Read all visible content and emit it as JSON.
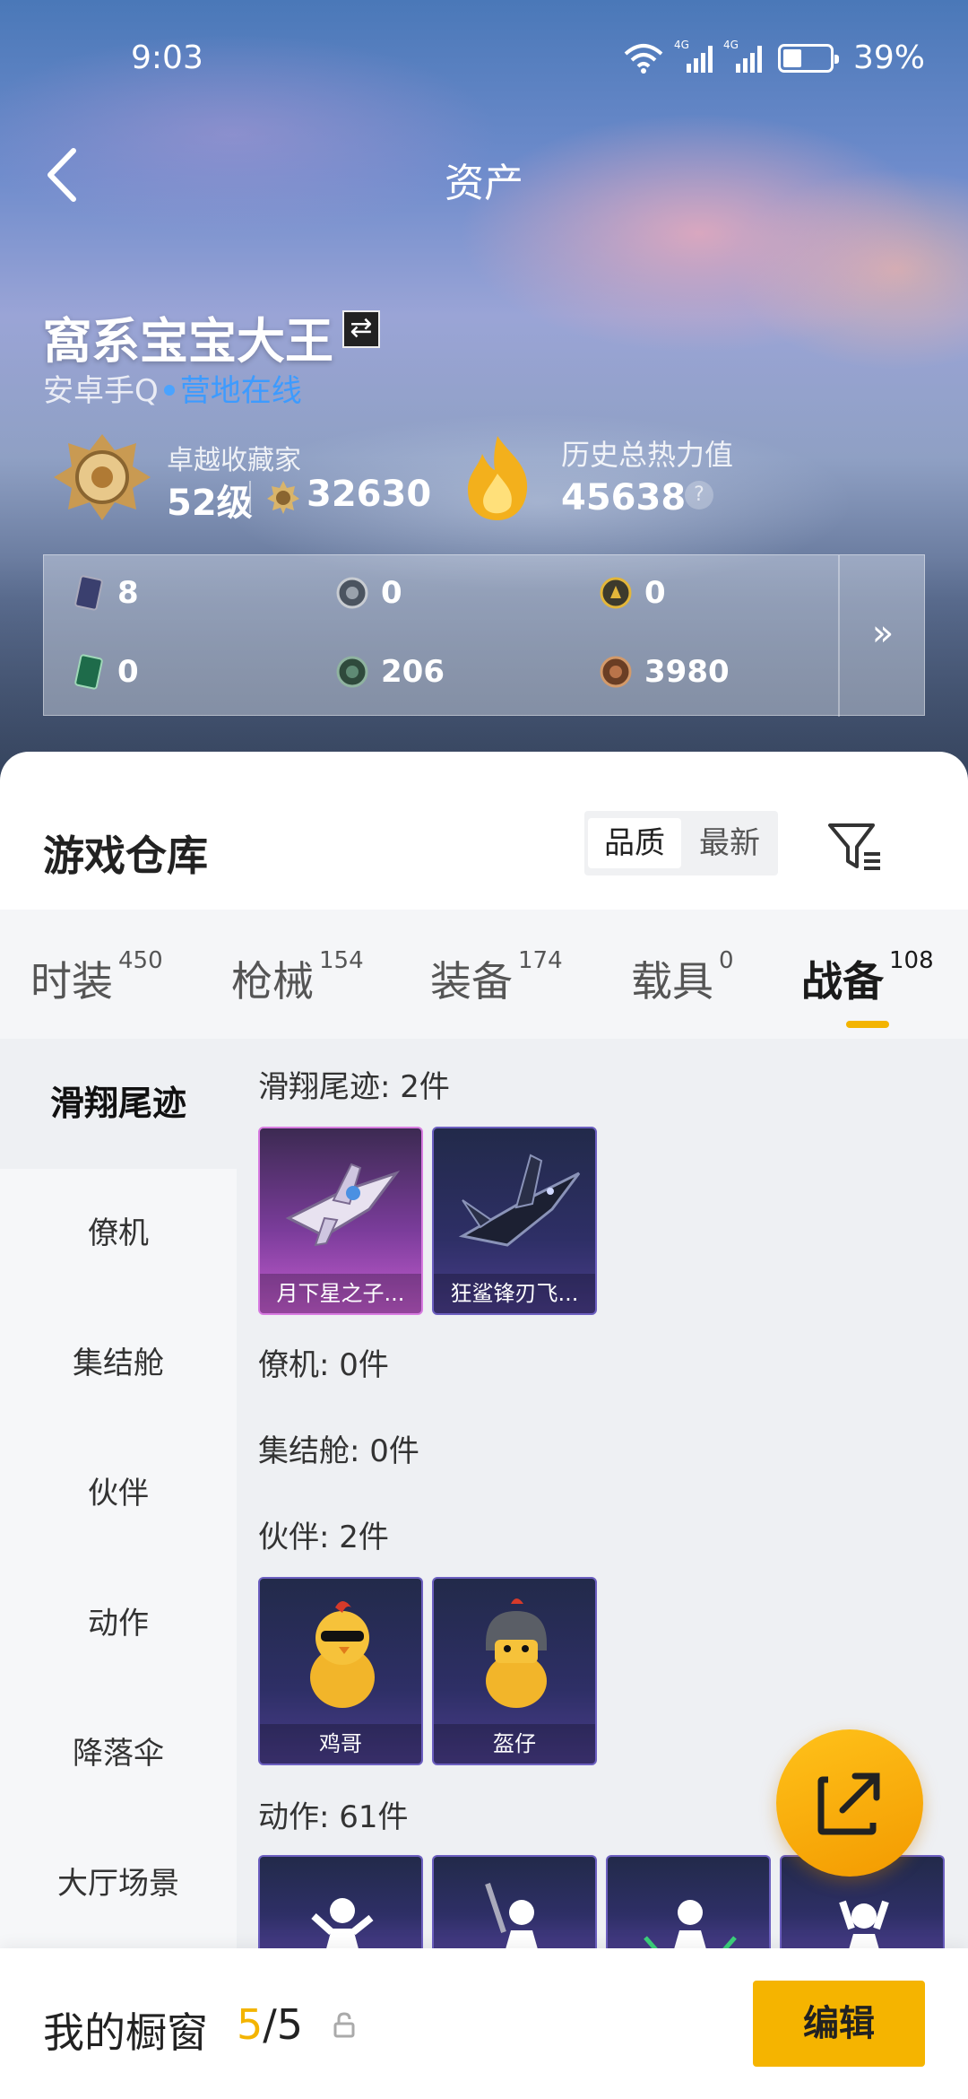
{
  "status": {
    "time": "9:03",
    "net1": "4G",
    "net2": "4G",
    "battery": "39%"
  },
  "header": {
    "title": "资产"
  },
  "profile": {
    "name": "窩系宝宝大王",
    "platform": "安卓手Q",
    "online": "营地在线",
    "collector_title": "卓越收藏家",
    "level": "52级",
    "coins": "32630",
    "heat_title": "历史总热力值",
    "heat": "45638",
    "help": "?"
  },
  "currencies": [
    {
      "icon": "card-ticket-icon",
      "value": "8"
    },
    {
      "icon": "silver-coin-icon",
      "value": "0"
    },
    {
      "icon": "gold-coin-icon",
      "value": "0"
    },
    {
      "icon": "green-card-icon",
      "value": "0"
    },
    {
      "icon": "green-coin-icon",
      "value": "206"
    },
    {
      "icon": "bronze-coin-icon",
      "value": "3980"
    }
  ],
  "more_arrow": "»",
  "warehouse": {
    "title": "游戏仓库",
    "sort": [
      "品质",
      "最新"
    ],
    "tabs": [
      {
        "label": "时装",
        "count": "450"
      },
      {
        "label": "枪械",
        "count": "154"
      },
      {
        "label": "装备",
        "count": "174"
      },
      {
        "label": "载具",
        "count": "0"
      },
      {
        "label": "战备",
        "count": "108"
      }
    ],
    "categories": [
      "滑翔尾迹",
      "僚机",
      "集结舱",
      "伙伴",
      "动作",
      "降落伞",
      "大厅场景"
    ],
    "sections": [
      {
        "title": "滑翔尾迹: 2件",
        "items": [
          "月下星之子...",
          "狂鲨锋刃飞..."
        ]
      },
      {
        "title": "僚机: 0件"
      },
      {
        "title": "集结舱: 0件"
      },
      {
        "title": "伙伴: 2件",
        "items": [
          "鸡哥",
          "盔仔"
        ]
      },
      {
        "title": "动作: 61件"
      }
    ]
  },
  "showcase": {
    "title": "我的橱窗",
    "current": "5",
    "total": "/5",
    "edit": "编辑"
  },
  "colors": {
    "accent": "#f5b400",
    "online": "#3d9bff"
  }
}
